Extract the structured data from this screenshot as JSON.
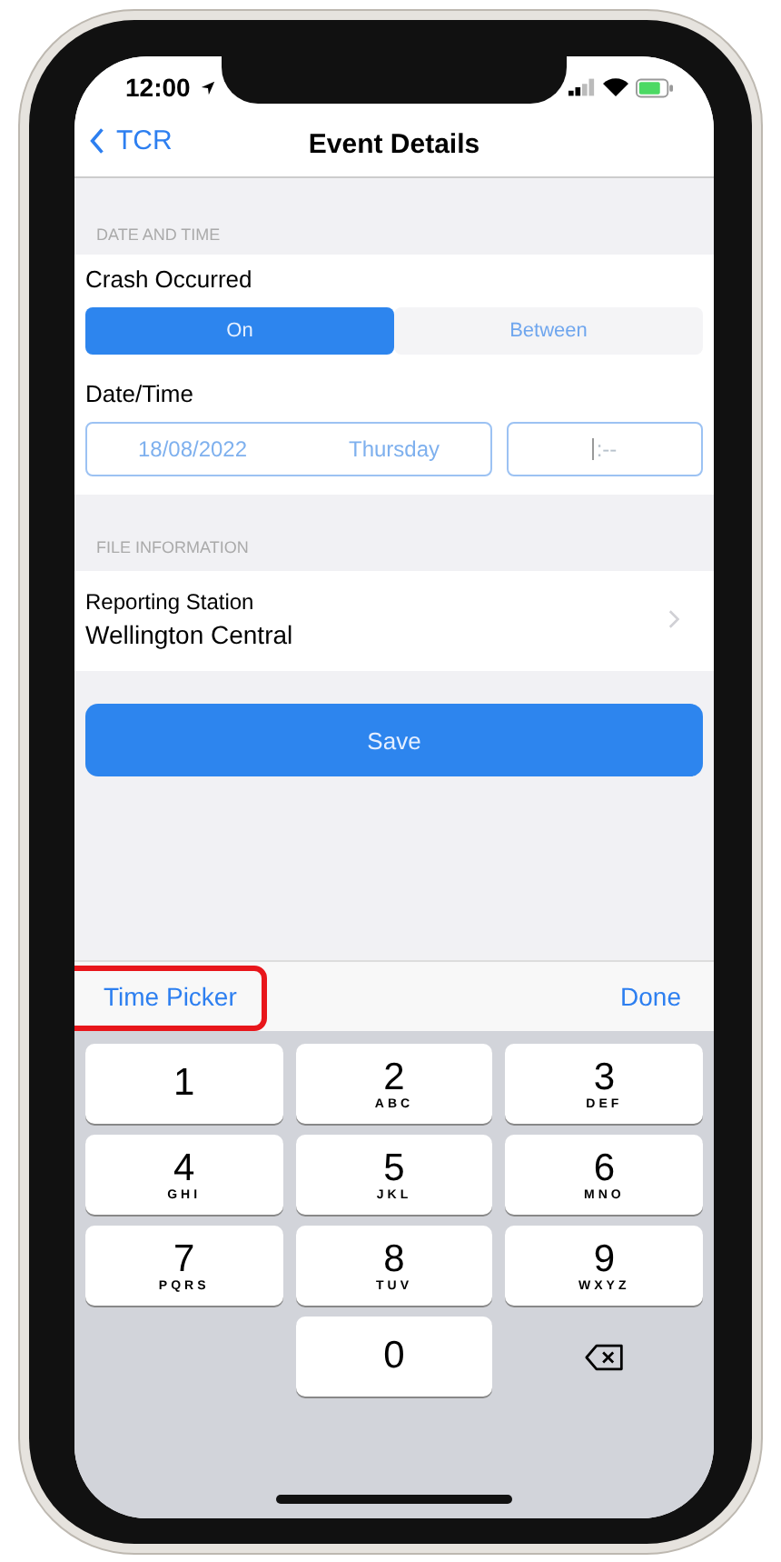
{
  "status_bar": {
    "time": "12:00"
  },
  "nav": {
    "back": "TCR",
    "title": "Event Details"
  },
  "sections": [
    {
      "header": "DATE AND TIME"
    },
    {
      "header": "FILE INFORMATION"
    }
  ],
  "crash": {
    "label": "Crash Occurred",
    "segments": [
      {
        "label": "On",
        "selected": true
      },
      {
        "label": "Between",
        "selected": false
      }
    ]
  },
  "datetime": {
    "label": "Date/Time",
    "date": "18/08/2022",
    "weekday": "Thursday",
    "time": ":--"
  },
  "station": {
    "label": "Reporting Station",
    "value": "Wellington Central"
  },
  "save": "Save",
  "toolbar": {
    "left": "Time Picker",
    "right": "Done"
  },
  "keys": [
    {
      "digit": "1"
    },
    {
      "digit": "2",
      "letters": "ABC"
    },
    {
      "digit": "3",
      "letters": "DEF"
    },
    {
      "digit": "4",
      "letters": "GHI"
    },
    {
      "digit": "5",
      "letters": "JKL"
    },
    {
      "digit": "6",
      "letters": "MNO"
    },
    {
      "digit": "7",
      "letters": "PQRS"
    },
    {
      "digit": "8",
      "letters": "TUV"
    },
    {
      "digit": "9",
      "letters": "WXYZ"
    },
    {
      "kind": "blank"
    },
    {
      "digit": "0"
    },
    {
      "kind": "delete"
    }
  ]
}
